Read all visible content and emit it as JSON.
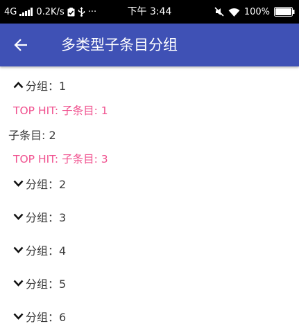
{
  "status_bar": {
    "network": "4G",
    "speed": "0.2K/s",
    "more": "···",
    "time": "下午 3:44",
    "battery": "100%",
    "icons": [
      "signal-icon",
      "clipboard-check-icon",
      "usb-icon",
      "mute-icon",
      "wifi-icon",
      "battery-icon"
    ]
  },
  "app_bar": {
    "title": "多类型子条目分组",
    "back_icon": "arrow-left-icon",
    "color": "#3f51b5"
  },
  "list": {
    "accent_color": "#f0508e",
    "groups": [
      {
        "label": "分组：1",
        "expanded": true,
        "children": [
          {
            "text": "TOP HIT: 子条目: 1",
            "style": "top_hit"
          },
          {
            "text": "子条目: 2",
            "style": "plain"
          },
          {
            "text": "TOP HIT: 子条目: 3",
            "style": "top_hit"
          }
        ]
      },
      {
        "label": "分组：2",
        "expanded": false
      },
      {
        "label": "分组：3",
        "expanded": false
      },
      {
        "label": "分组：4",
        "expanded": false
      },
      {
        "label": "分组：5",
        "expanded": false
      },
      {
        "label": "分组：6",
        "expanded": false
      }
    ]
  }
}
